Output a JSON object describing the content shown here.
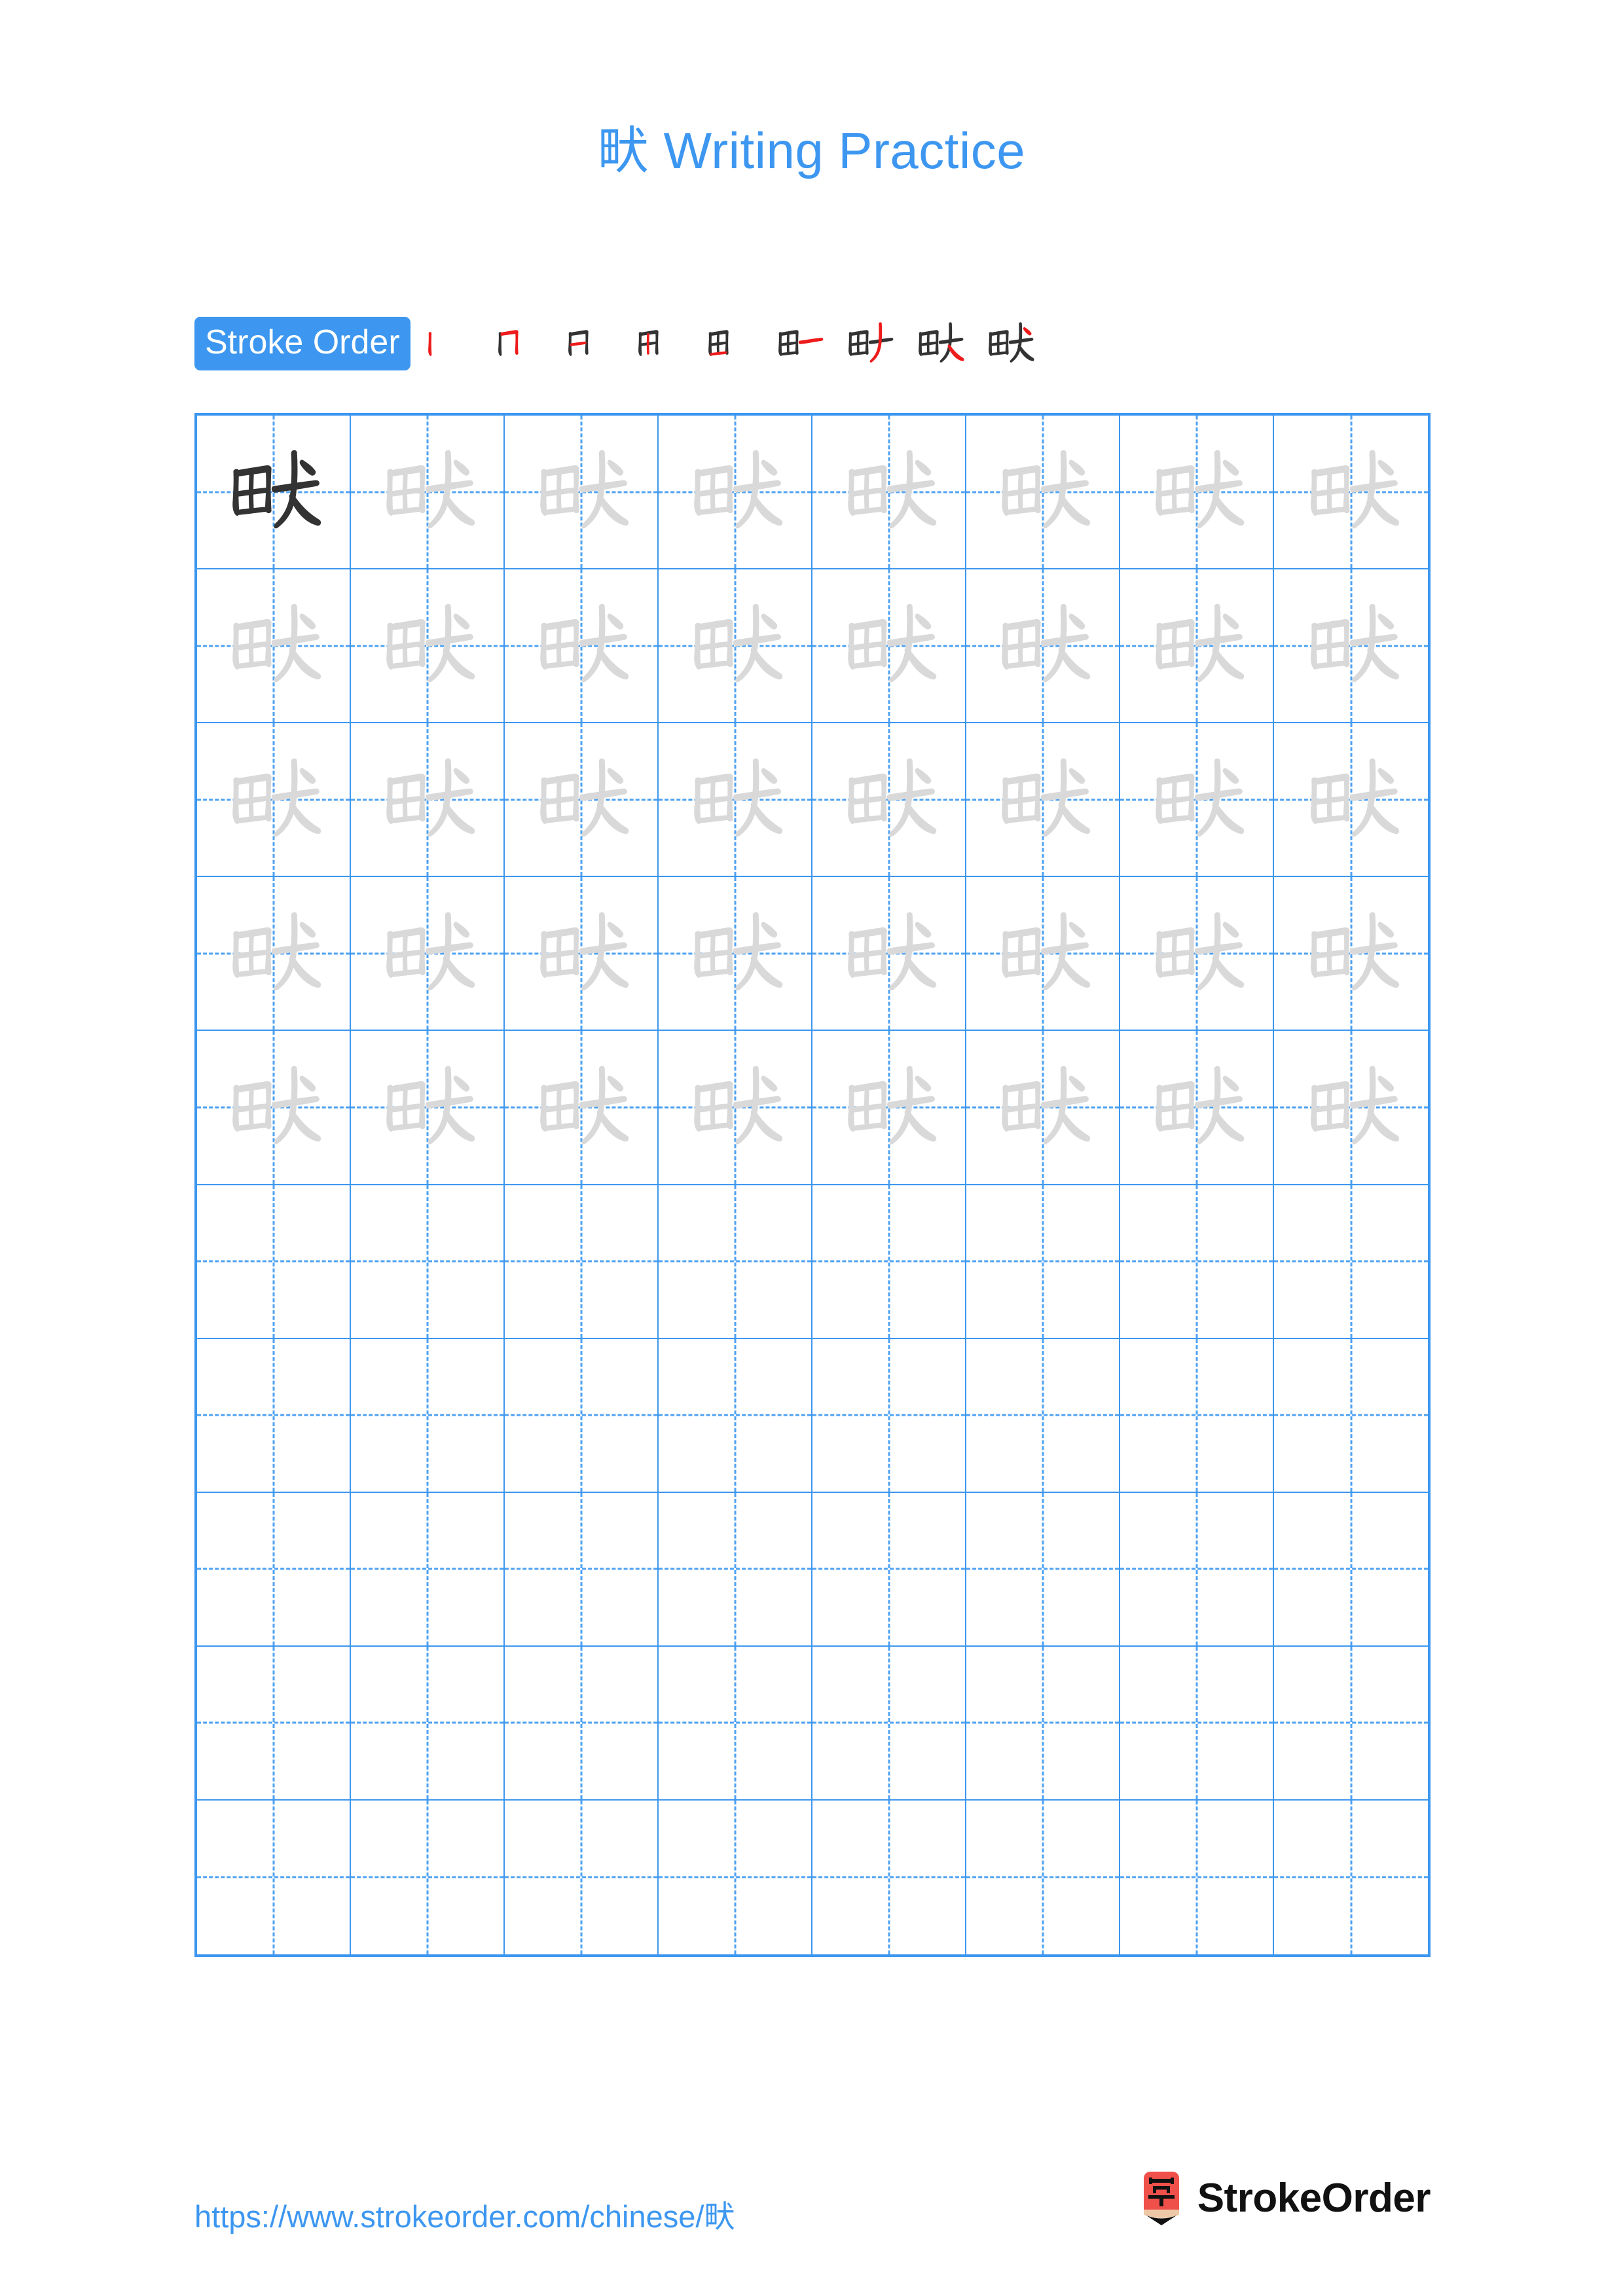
{
  "page": {
    "character": "畎",
    "title": "畎 Writing Practice",
    "title_suffix": " Writing Practice",
    "background_color": "#ffffff",
    "accent_color": "#3d97f0",
    "trace_color": "#d9d9d9",
    "ink_color": "#333333",
    "new_stroke_color": "#ee1b1b"
  },
  "stroke_order": {
    "badge_label": "Stroke Order",
    "badge_bg_color": "#3d97f0",
    "badge_text_color": "#ffffff",
    "total_strokes": 9,
    "steps": [
      {
        "index": 1,
        "strokes_drawn": 1,
        "label": "丨"
      },
      {
        "index": 2,
        "strokes_drawn": 2,
        "label": "冂"
      },
      {
        "index": 3,
        "strokes_drawn": 3,
        "label": "日"
      },
      {
        "index": 4,
        "strokes_drawn": 4,
        "label": "甲"
      },
      {
        "index": 5,
        "strokes_drawn": 5,
        "label": "田"
      },
      {
        "index": 6,
        "strokes_drawn": 6,
        "label": "田一"
      },
      {
        "index": 7,
        "strokes_drawn": 7,
        "label": "畎"
      },
      {
        "index": 8,
        "strokes_drawn": 8,
        "label": "畎"
      },
      {
        "index": 9,
        "strokes_drawn": 9,
        "label": "畎"
      }
    ]
  },
  "grid": {
    "columns": 8,
    "rows": 10,
    "border_color": "#3d97f0",
    "guide_color": "#4ea2f2",
    "filled_rows": 5,
    "empty_rows": 5,
    "cells": [
      [
        "ink",
        "trace",
        "trace",
        "trace",
        "trace",
        "trace",
        "trace",
        "trace"
      ],
      [
        "trace",
        "trace",
        "trace",
        "trace",
        "trace",
        "trace",
        "trace",
        "trace"
      ],
      [
        "trace",
        "trace",
        "trace",
        "trace",
        "trace",
        "trace",
        "trace",
        "trace"
      ],
      [
        "trace",
        "trace",
        "trace",
        "trace",
        "trace",
        "trace",
        "trace",
        "trace"
      ],
      [
        "trace",
        "trace",
        "trace",
        "trace",
        "trace",
        "trace",
        "trace",
        "trace"
      ],
      [
        "empty",
        "empty",
        "empty",
        "empty",
        "empty",
        "empty",
        "empty",
        "empty"
      ],
      [
        "empty",
        "empty",
        "empty",
        "empty",
        "empty",
        "empty",
        "empty",
        "empty"
      ],
      [
        "empty",
        "empty",
        "empty",
        "empty",
        "empty",
        "empty",
        "empty",
        "empty"
      ],
      [
        "empty",
        "empty",
        "empty",
        "empty",
        "empty",
        "empty",
        "empty",
        "empty"
      ],
      [
        "empty",
        "empty",
        "empty",
        "empty",
        "empty",
        "empty",
        "empty",
        "empty"
      ]
    ]
  },
  "footer": {
    "url": "https://www.strokeorder.com/chinese/畎",
    "brand_name": "StrokeOrder",
    "brand_mark_character": "字",
    "brand_mark_color": "#f0504a",
    "brand_mark_tip_color": "#edc9a8"
  }
}
